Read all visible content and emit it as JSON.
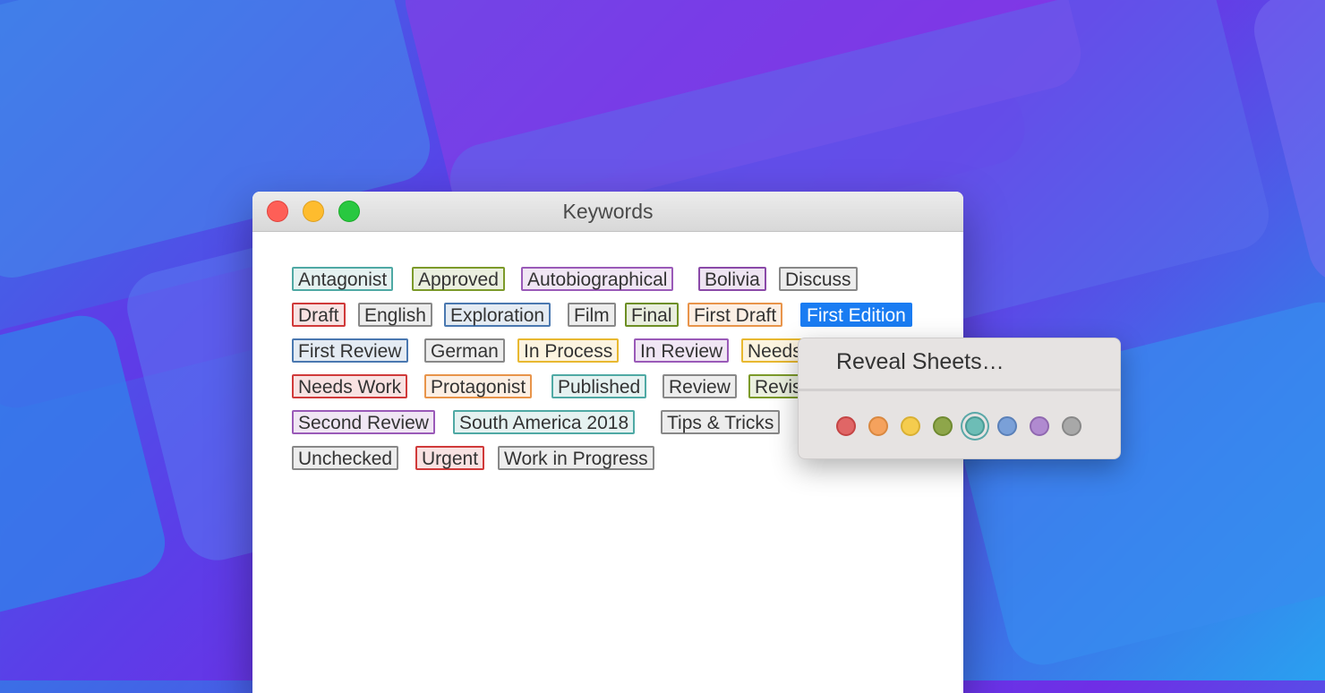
{
  "window": {
    "title": "Keywords"
  },
  "keywords": [
    [
      {
        "label": "Antagonist",
        "color": "#4fa9a4"
      },
      {
        "label": "Approved",
        "color": "#7c9a2a"
      },
      {
        "label": "Autobiographical",
        "color": "#9a5ab8"
      },
      {
        "label": "Bolivia",
        "color": "#8a4aa8"
      },
      {
        "label": "Discuss",
        "color": "#888888"
      }
    ],
    [
      {
        "label": "Draft",
        "color": "#d03a3a"
      },
      {
        "label": "English",
        "color": "#888888"
      },
      {
        "label": "Exploration",
        "color": "#4a78b0"
      },
      {
        "label": "Film",
        "color": "#888888"
      },
      {
        "label": "Final",
        "color": "#6d8f24"
      },
      {
        "label": "First Draft",
        "color": "#e8944a"
      },
      {
        "label": "First Edition",
        "color": "#1a7cf2",
        "selected": true
      }
    ],
    [
      {
        "label": "First Review",
        "color": "#4a78b0"
      },
      {
        "label": "German",
        "color": "#888888"
      },
      {
        "label": "In Process",
        "color": "#e8b830"
      },
      {
        "label": "In Review",
        "color": "#9a5ab8"
      },
      {
        "label": "Needs",
        "color": "#e8b830"
      }
    ],
    [
      {
        "label": "Needs Work",
        "color": "#d03a3a"
      },
      {
        "label": "Protagonist",
        "color": "#e8944a"
      },
      {
        "label": "Published",
        "color": "#4fa9a4"
      },
      {
        "label": "Review",
        "color": "#888888"
      },
      {
        "label": "Revis",
        "color": "#7c9a2a"
      }
    ],
    [
      {
        "label": "Second Review",
        "color": "#9a5ab8"
      },
      {
        "label": "South America 2018",
        "color": "#4fa9a4"
      },
      {
        "label": "Tips & Tricks",
        "color": "#888888"
      }
    ],
    [
      {
        "label": "Unchecked",
        "color": "#888888"
      },
      {
        "label": "Urgent",
        "color": "#d03a3a"
      },
      {
        "label": "Work in Progress",
        "color": "#888888"
      }
    ]
  ],
  "context_menu": {
    "item": "Reveal Sheets…",
    "colors": [
      {
        "name": "red",
        "fill": "#e06666",
        "stroke": "#c44444"
      },
      {
        "name": "orange",
        "fill": "#f5a25d",
        "stroke": "#d98840"
      },
      {
        "name": "yellow",
        "fill": "#f5cc4e",
        "stroke": "#d9b033"
      },
      {
        "name": "green",
        "fill": "#8ea64a",
        "stroke": "#6f8a30"
      },
      {
        "name": "teal",
        "fill": "#6dbdb6",
        "stroke": "#4a9c96",
        "active": true
      },
      {
        "name": "blue",
        "fill": "#7aa0d8",
        "stroke": "#5a80b8"
      },
      {
        "name": "purple",
        "fill": "#b08ad0",
        "stroke": "#9068b0"
      },
      {
        "name": "gray",
        "fill": "#a8a8a8",
        "stroke": "#888888"
      }
    ]
  }
}
